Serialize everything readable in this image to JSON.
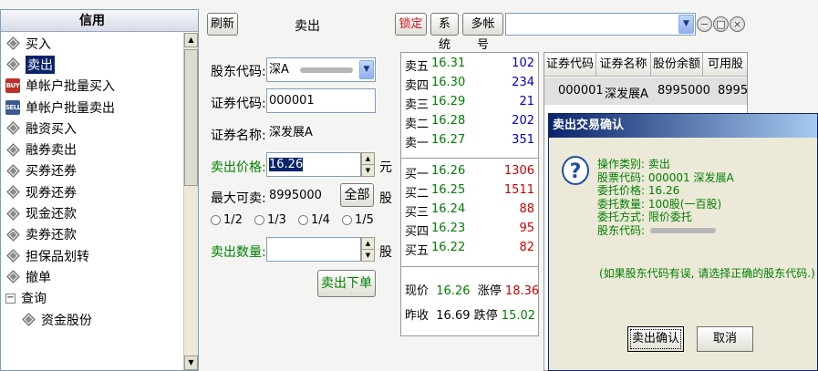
{
  "nav": {
    "title": "信用",
    "items": [
      {
        "label": "买入",
        "icon": "diamond-icon"
      },
      {
        "label": "卖出",
        "icon": "diamond-icon",
        "selected": true
      },
      {
        "label": "单帐户批量买入",
        "icon": "buy-badge-icon",
        "badge": "BUY"
      },
      {
        "label": "单帐户批量卖出",
        "icon": "sell-badge-icon",
        "badge": "SELL"
      },
      {
        "label": "融资买入",
        "icon": "diamond-icon"
      },
      {
        "label": "融券卖出",
        "icon": "diamond-icon"
      },
      {
        "label": "买券还券",
        "icon": "diamond-icon"
      },
      {
        "label": "现券还券",
        "icon": "diamond-icon"
      },
      {
        "label": "现金还款",
        "icon": "diamond-icon"
      },
      {
        "label": "卖券还款",
        "icon": "diamond-icon"
      },
      {
        "label": "担保品划转",
        "icon": "diamond-icon"
      },
      {
        "label": "撤单",
        "icon": "diamond-icon"
      },
      {
        "label": "查询",
        "icon": "collapse-icon",
        "expander": "−"
      },
      {
        "label": "资金股份",
        "icon": "diamond-icon",
        "child": true
      }
    ]
  },
  "toolbar": {
    "refresh": "刷新",
    "title": "卖出",
    "lock": "锁定",
    "system": "系统",
    "multi_account": "多帐号"
  },
  "form": {
    "shareholder_label": "股东代码:",
    "shareholder_value": "深A",
    "stock_code_label": "证券代码:",
    "stock_code_value": "000001",
    "stock_name_label": "证券名称:",
    "stock_name_value": "深发展A",
    "price_label": "卖出价格:",
    "price_value": "16.26",
    "price_unit": "元",
    "max_label": "最大可卖:",
    "max_value": "8995000",
    "all_button": "全部",
    "max_unit": "股",
    "ratios": [
      "1/2",
      "1/3",
      "1/4",
      "1/5"
    ],
    "qty_label": "卖出数量:",
    "qty_value": "",
    "qty_unit": "股",
    "submit": "卖出下单"
  },
  "quote": {
    "asks": [
      {
        "name": "卖五",
        "price": "16.31",
        "vol": "102"
      },
      {
        "name": "卖四",
        "price": "16.30",
        "vol": "234"
      },
      {
        "name": "卖三",
        "price": "16.29",
        "vol": "21"
      },
      {
        "name": "卖二",
        "price": "16.28",
        "vol": "202"
      },
      {
        "name": "卖一",
        "price": "16.27",
        "vol": "351"
      }
    ],
    "bids": [
      {
        "name": "买一",
        "price": "16.26",
        "vol": "1306"
      },
      {
        "name": "买二",
        "price": "16.25",
        "vol": "1511"
      },
      {
        "name": "买三",
        "price": "16.24",
        "vol": "88"
      },
      {
        "name": "买四",
        "price": "16.23",
        "vol": "95"
      },
      {
        "name": "买五",
        "price": "16.22",
        "vol": "82"
      }
    ],
    "current_label": "现价",
    "current_value": "16.26",
    "limit_up_label": "涨停",
    "limit_up_value": "18.36",
    "prev_close_label": "昨收",
    "prev_close_value": "16.69",
    "limit_down_label": "跌停",
    "limit_down_value": "15.02"
  },
  "holdings": {
    "columns": [
      "证券代码",
      "证券名称",
      "股份余额",
      "可用股"
    ],
    "rows": [
      {
        "code": "000001",
        "name": "深发展A",
        "balance": "8995000",
        "available": "8995"
      }
    ]
  },
  "dialog": {
    "title": "卖出交易确认",
    "lines": [
      "操作类别: 卖出",
      "股票代码: 000001   深发展A",
      "委托价格: 16.26",
      "委托数量: 100股(一百股)",
      "委托方式: 限价委托",
      "股东代码:"
    ],
    "hint": "(如果股东代码有误, 请选择正确的股东代码.)",
    "confirm": "卖出确认",
    "cancel": "取消"
  }
}
